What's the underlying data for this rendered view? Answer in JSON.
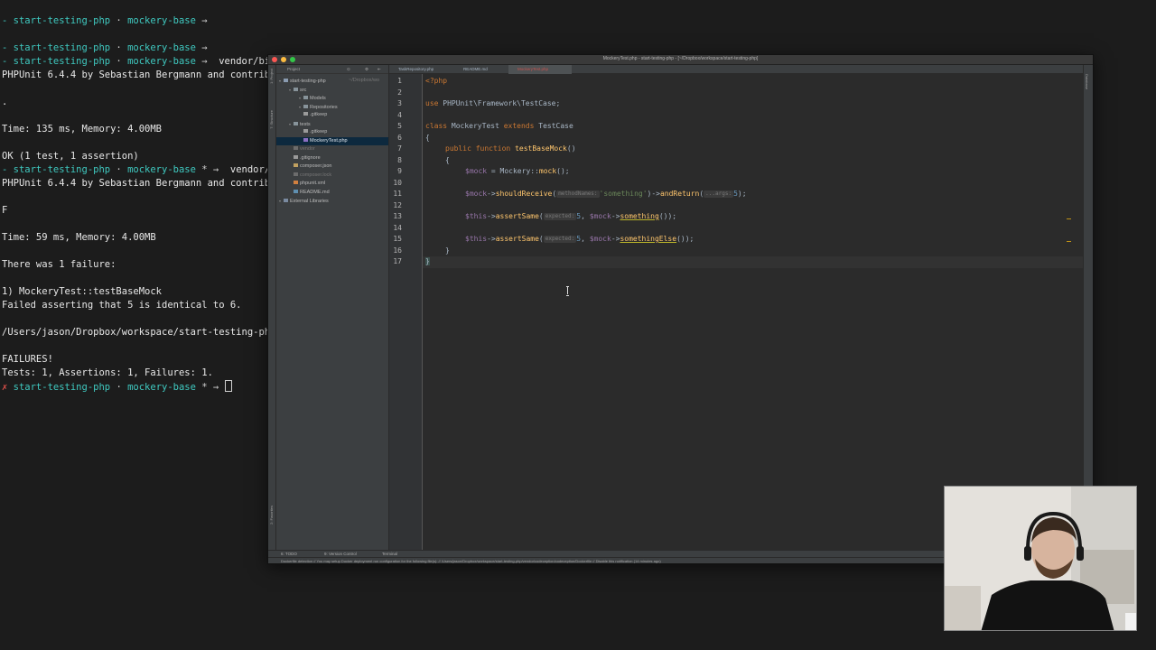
{
  "terminal": {
    "lines": [
      {
        "prompt": "- start-testing-php",
        "sep": " · ",
        "branch": "mockery-base",
        "tail": " →",
        "text": ""
      },
      {
        "prompt": "",
        "sep": "",
        "branch": "",
        "tail": "",
        "text": ""
      },
      {
        "prompt": "- start-testing-php",
        "sep": " · ",
        "branch": "mockery-base",
        "tail": " →",
        "text": ""
      },
      {
        "prompt": "- start-testing-php",
        "sep": " · ",
        "branch": "mockery-base",
        "tail": " →",
        "text": "  vendor/bin/"
      },
      {
        "prompt": "",
        "sep": "",
        "branch": "",
        "tail": "",
        "text": "PHPUnit 6.4.4 by Sebastian Bergmann and contribut"
      },
      {
        "prompt": "",
        "sep": "",
        "branch": "",
        "tail": "",
        "text": ""
      },
      {
        "prompt": "",
        "sep": "",
        "branch": "",
        "tail": "",
        "text": "."
      },
      {
        "prompt": "",
        "sep": "",
        "branch": "",
        "tail": "",
        "text": ""
      },
      {
        "prompt": "",
        "sep": "",
        "branch": "",
        "tail": "",
        "text": "Time: 135 ms, Memory: 4.00MB"
      },
      {
        "prompt": "",
        "sep": "",
        "branch": "",
        "tail": "",
        "text": ""
      },
      {
        "prompt": "",
        "sep": "",
        "branch": "",
        "tail": "",
        "text": "OK (1 test, 1 assertion)"
      },
      {
        "prompt": "- start-testing-php",
        "sep": " · ",
        "branch": "mockery-base",
        "tail": " * →",
        "text": "  vendor/bi"
      },
      {
        "prompt": "",
        "sep": "",
        "branch": "",
        "tail": "",
        "text": "PHPUnit 6.4.4 by Sebastian Bergmann and contribut"
      },
      {
        "prompt": "",
        "sep": "",
        "branch": "",
        "tail": "",
        "text": ""
      },
      {
        "prompt": "",
        "sep": "",
        "branch": "",
        "tail": "",
        "text": "F"
      },
      {
        "prompt": "",
        "sep": "",
        "branch": "",
        "tail": "",
        "text": ""
      },
      {
        "prompt": "",
        "sep": "",
        "branch": "",
        "tail": "",
        "text": "Time: 59 ms, Memory: 4.00MB"
      },
      {
        "prompt": "",
        "sep": "",
        "branch": "",
        "tail": "",
        "text": ""
      },
      {
        "prompt": "",
        "sep": "",
        "branch": "",
        "tail": "",
        "text": "There was 1 failure:"
      },
      {
        "prompt": "",
        "sep": "",
        "branch": "",
        "tail": "",
        "text": ""
      },
      {
        "prompt": "",
        "sep": "",
        "branch": "",
        "tail": "",
        "text": "1) MockeryTest::testBaseMock"
      },
      {
        "prompt": "",
        "sep": "",
        "branch": "",
        "tail": "",
        "text": "Failed asserting that 5 is identical to 6."
      },
      {
        "prompt": "",
        "sep": "",
        "branch": "",
        "tail": "",
        "text": ""
      },
      {
        "prompt": "",
        "sep": "",
        "branch": "",
        "tail": "",
        "text": "/Users/jason/Dropbox/workspace/start-testing-php/"
      },
      {
        "prompt": "",
        "sep": "",
        "branch": "",
        "tail": "",
        "text": ""
      },
      {
        "prompt": "",
        "sep": "",
        "branch": "",
        "tail": "",
        "text": "FAILURES!"
      },
      {
        "prompt": "",
        "sep": "",
        "branch": "",
        "tail": "",
        "text": "Tests: 1, Assertions: 1, Failures: 1."
      }
    ],
    "last_prompt": {
      "mark": "✗",
      "prompt": " start-testing-php",
      "sep": " · ",
      "branch": "mockery-base",
      "tail": " * →"
    }
  },
  "ide": {
    "title": "MockeryTest.php - start-testing-php - [~/Dropbox/workspace/start-testing-php]",
    "project_header": "Project",
    "project_path": "~/Dropbox/wo",
    "tree": [
      {
        "label": "start-testing-php",
        "indent": 0,
        "type": "root"
      },
      {
        "label": "src",
        "indent": 1,
        "type": "folder"
      },
      {
        "label": "Models",
        "indent": 2,
        "type": "folder"
      },
      {
        "label": "Repositories",
        "indent": 2,
        "type": "folder"
      },
      {
        "label": ".gitkeep",
        "indent": 2,
        "type": "file"
      },
      {
        "label": "tests",
        "indent": 1,
        "type": "folder"
      },
      {
        "label": ".gitkeep",
        "indent": 2,
        "type": "file"
      },
      {
        "label": "MockeryTest.php",
        "indent": 2,
        "type": "php",
        "selected": true
      },
      {
        "label": "vendor",
        "indent": 1,
        "type": "dim"
      },
      {
        "label": ".gitignore",
        "indent": 1,
        "type": "file"
      },
      {
        "label": "composer.json",
        "indent": 1,
        "type": "json"
      },
      {
        "label": "composer.lock",
        "indent": 1,
        "type": "dim"
      },
      {
        "label": "phpunit.xml",
        "indent": 1,
        "type": "xml"
      },
      {
        "label": "README.md",
        "indent": 1,
        "type": "md"
      },
      {
        "label": "External Libraries",
        "indent": 0,
        "type": "lib"
      }
    ],
    "tabs": [
      {
        "label": "TaskRepository.php",
        "active": false
      },
      {
        "label": "README.md",
        "active": false
      },
      {
        "label": "MockeryTest.php",
        "active": true
      }
    ],
    "line_numbers": [
      "1",
      "2",
      "3",
      "4",
      "5",
      "6",
      "7",
      "8",
      "9",
      "10",
      "11",
      "12",
      "13",
      "14",
      "15",
      "16",
      "17"
    ],
    "code": {
      "l1": "<?php",
      "l3_kw": "use",
      "l3_ns": " PHPUnit\\Framework\\TestCase;",
      "l5_kw": "class",
      "l5_name": " MockeryTest ",
      "l5_ext": "extends",
      "l5_base": " TestCase",
      "l6": "{",
      "l7_kw": "public function",
      "l7_fn": " testBaseMock",
      "l7_tail": "()",
      "l8": "{",
      "l9_var": "$mock",
      "l9_rest": " = Mockery::",
      "l9_fn": "mock",
      "l9_tail": "();",
      "l11_var": "$mock",
      "l11_arrow": "->",
      "l11_fn": "shouldReceive",
      "l11_open": "(",
      "l11_hint": "methodNames:",
      "l11_str": "'something'",
      "l11_mid": ")->",
      "l11_fn2": "andReturn",
      "l11_open2": "(",
      "l11_hint2": "...args:",
      "l11_val": "5",
      "l11_tail": ");",
      "l13_var": "$this",
      "l13_arrow": "->",
      "l13_fn": "assertSame",
      "l13_open": "(",
      "l13_hint": "expected:",
      "l13_val": "5",
      "l13_sep": ", ",
      "l13_var2": "$mock",
      "l13_arrow2": "->",
      "l13_call": "something",
      "l13_tail": "());",
      "l15_var": "$this",
      "l15_arrow": "->",
      "l15_fn": "assertSame",
      "l15_open": "(",
      "l15_hint": "expected:",
      "l15_val": "5",
      "l15_sep": ", ",
      "l15_var2": "$mock",
      "l15_arrow2": "->",
      "l15_call": "somethingElse",
      "l15_tail": "());",
      "l16": "}",
      "l17": "}"
    },
    "bottom_tools": [
      "6: TODO",
      "9: Version Control",
      "Terminal"
    ],
    "status_text": "Dockerfile detection // You may setup Docker deployment run configuration for the following file(s): // /Users/jason/Dropbox/workspace/start-testing-php/vendor/codeception/codeception/Dockerfile // Disable this notification (14 minutes ago)",
    "side_labels": [
      "1: Project",
      "7: Structure",
      "2: Favorites"
    ],
    "right_label": "Database"
  }
}
